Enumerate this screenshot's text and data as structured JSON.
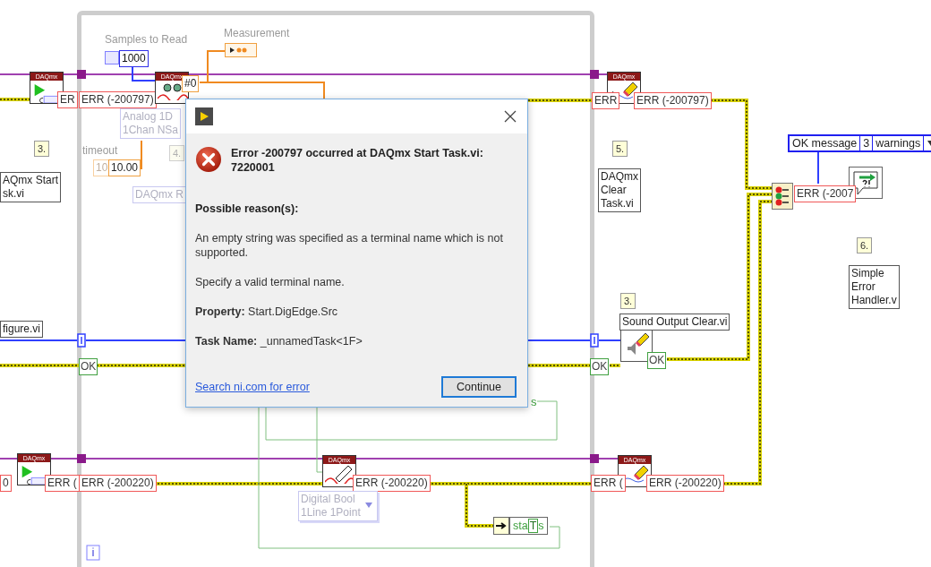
{
  "diagram": {
    "items": [
      {
        "kind": "label",
        "text": "Samples to Read"
      },
      {
        "kind": "label",
        "text": "Measurement"
      },
      {
        "kind": "const",
        "text": "1000"
      },
      {
        "kind": "node",
        "text": "DAQmx"
      },
      {
        "kind": "err",
        "text": "ER"
      },
      {
        "kind": "err",
        "text": "ERR (-200797)"
      },
      {
        "kind": "node",
        "text": "DAQmx"
      },
      {
        "kind": "orange",
        "text": "#0"
      },
      {
        "kind": "faded",
        "text": "Analog 1D\n1Chan NSa"
      },
      {
        "kind": "step",
        "text": "3."
      },
      {
        "kind": "label",
        "text": "timeout"
      },
      {
        "kind": "faded-orange",
        "text": "10"
      },
      {
        "kind": "orange",
        "text": "10.00"
      },
      {
        "kind": "faded-step",
        "text": "4."
      },
      {
        "kind": "comment",
        "text": "AQmx Start\nsk.vi"
      },
      {
        "kind": "faded",
        "text": "DAQmx R"
      },
      {
        "kind": "node",
        "text": "DAQmx"
      },
      {
        "kind": "err",
        "text": "ERR"
      },
      {
        "kind": "err",
        "text": "ERR (-200797)"
      },
      {
        "kind": "step",
        "text": "5."
      },
      {
        "kind": "comment",
        "text": "DAQmx\nClear\nTask.vi"
      },
      {
        "kind": "cluster",
        "parts": [
          "OK message",
          "3",
          "warnings"
        ]
      },
      {
        "kind": "err",
        "text": "ERR (-2007"
      },
      {
        "kind": "step",
        "text": "6."
      },
      {
        "kind": "step",
        "text": "3."
      },
      {
        "kind": "comment",
        "text": "Simple\nError\nHandler.v"
      },
      {
        "kind": "comment",
        "text": "Sound Output Clear.vi"
      },
      {
        "kind": "comment",
        "text": "figure.vi"
      },
      {
        "kind": "ok",
        "text": "OK"
      },
      {
        "kind": "ok",
        "text": "OK"
      },
      {
        "kind": "ok",
        "text": "OK"
      },
      {
        "kind": "node",
        "text": "DAQmx"
      },
      {
        "kind": "err",
        "text": "0"
      },
      {
        "kind": "err",
        "text": "ERR ("
      },
      {
        "kind": "err",
        "text": "ERR (-200220)"
      },
      {
        "kind": "node",
        "text": "DAQmx"
      },
      {
        "kind": "err",
        "text": "ERR (-200220)"
      },
      {
        "kind": "enum",
        "text": "Digital Bool\n1Line 1Point"
      },
      {
        "kind": "node",
        "text": "DAQmx"
      },
      {
        "kind": "err",
        "text": "ERR ("
      },
      {
        "kind": "err",
        "text": "ERR (-200220)"
      },
      {
        "kind": "status",
        "parts": [
          "sta",
          "T",
          "s"
        ]
      },
      {
        "kind": "green",
        "text": "s"
      }
    ]
  },
  "dialog": {
    "heading": "Error -200797 occurred at DAQmx Start Task.vi: 7220001",
    "paragraphs": [
      {
        "kind": "heading",
        "text": "Possible reason(s):"
      },
      {
        "kind": "text",
        "text": "An empty string was specified as a terminal name which is not supported."
      },
      {
        "kind": "text",
        "text": "Specify a valid terminal name."
      },
      {
        "kind": "text",
        "text": "**Property:** Start.DigEdge.Src"
      },
      {
        "kind": "text",
        "text": "**Task Name:** _unnamedTask<1F>"
      }
    ],
    "link": "Search ni.com for error",
    "button": "Continue"
  }
}
